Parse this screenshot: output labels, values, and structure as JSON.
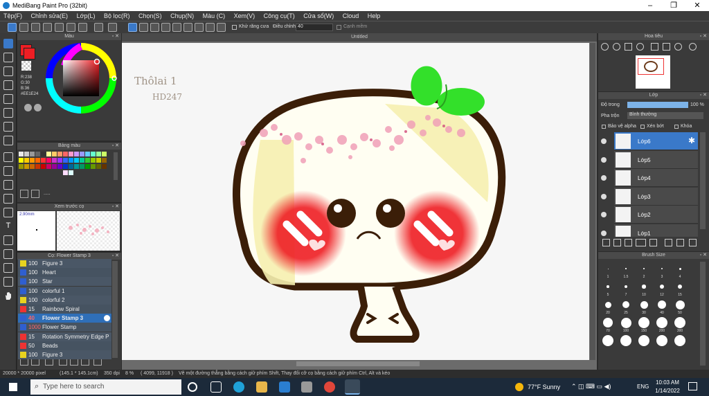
{
  "window": {
    "title": "MediBang Paint Pro (32bit)",
    "controls": [
      "–",
      "❐",
      "✕"
    ]
  },
  "menu": [
    "Tệp(F)",
    "Chỉnh sửa(E)",
    "Lớp(L)",
    "Bộ lọc(R)",
    "Chọn(S)",
    "Chụp(N)",
    "Màu (C)",
    "Xem(V)",
    "Công cụ(T)",
    "Cửa sổ(W)",
    "Cloud",
    "Help"
  ],
  "toolbar": {
    "antialias_label": "Khử răng cưa",
    "correction_label": "Điều chỉnh",
    "correction_value": "40",
    "edge_label": "Cạnh mềm"
  },
  "color_panel": {
    "title": "Màu",
    "r": "R:238",
    "g": "G:30",
    "b": "B:36",
    "hex": "#EE1E24",
    "primary": "#ee1e24"
  },
  "swatch_panel": {
    "title": "Bảng màu",
    "more": "....."
  },
  "preview_panel": {
    "title": "Xem trước cọ",
    "size": "2.90mm"
  },
  "brush_panel": {
    "title": "Cọ: Flower Stamp 3",
    "items": [
      {
        "size": "100",
        "name": "Figure 3",
        "color": "#e8d31f"
      },
      {
        "size": "100",
        "name": "Heart",
        "color": "#2f5fd0"
      },
      {
        "size": "100",
        "name": "Star",
        "color": "#2f5fd0"
      },
      {
        "size": "100",
        "name": "colorful 1",
        "color": "#2f5fd0"
      },
      {
        "size": "100",
        "name": "colorful 2",
        "color": "#e8d31f"
      },
      {
        "size": "15",
        "name": "Rainbow Spiral",
        "color": "#e33"
      },
      {
        "size": "40",
        "name": "Flower Stamp 3",
        "color": "#2f5fd0"
      },
      {
        "size": "1000",
        "name": "Flower Stamp",
        "color": "#2f5fd0"
      },
      {
        "size": "15",
        "name": "Rotation Symmetry Edge P",
        "color": "#e33"
      },
      {
        "size": "50",
        "name": "Beads",
        "color": "#e33"
      },
      {
        "size": "100",
        "name": "Figure 3",
        "color": "#e8d31f"
      }
    ]
  },
  "document": {
    "tab": "Untitled",
    "handwriting_1": "Thôlai 1",
    "handwriting_2": "HD247"
  },
  "navigator_panel": {
    "title": "Hoa tiêu"
  },
  "layer_panel": {
    "title": "Lớp",
    "opacity_label": "Độ trong",
    "opacity_value": "100 %",
    "blend_label": "Pha trộn",
    "blend_value": "Bình thường",
    "protect_alpha": "Bảo vệ alpha",
    "clipping": "Xén bớt",
    "lock": "Khóa",
    "layers": [
      "Lớp6",
      "Lớp5",
      "Lớp4",
      "Lớp3",
      "Lớp2",
      "Lớp1"
    ]
  },
  "brush_size_panel": {
    "title": "Brush Size",
    "sizes": [
      "1",
      "1.5",
      "2",
      "3",
      "4",
      "5",
      "7",
      "10",
      "12",
      "15",
      "20",
      "25",
      "30",
      "40",
      "50",
      "70",
      "100",
      "150",
      "200",
      "300",
      "",
      "",
      "",
      "",
      ""
    ]
  },
  "status": {
    "pixels": "20000 * 20000 pixel",
    "cm": "(145.1 * 145.1cm)",
    "dpi": "350 dpi",
    "zoom": "8 %",
    "coords": "( 4099, 11918 )",
    "hint": "Vẽ một đường thẳng bằng cách giữ phím Shift, Thay đổi cỡ cọ bằng cách giữ phím Ctrl, Alt và kéo"
  },
  "taskbar": {
    "search": "Type here to search",
    "weather": "77°F  Sunny",
    "lang": "ENG",
    "time": "10:03 AM",
    "date": "1/14/2022"
  }
}
